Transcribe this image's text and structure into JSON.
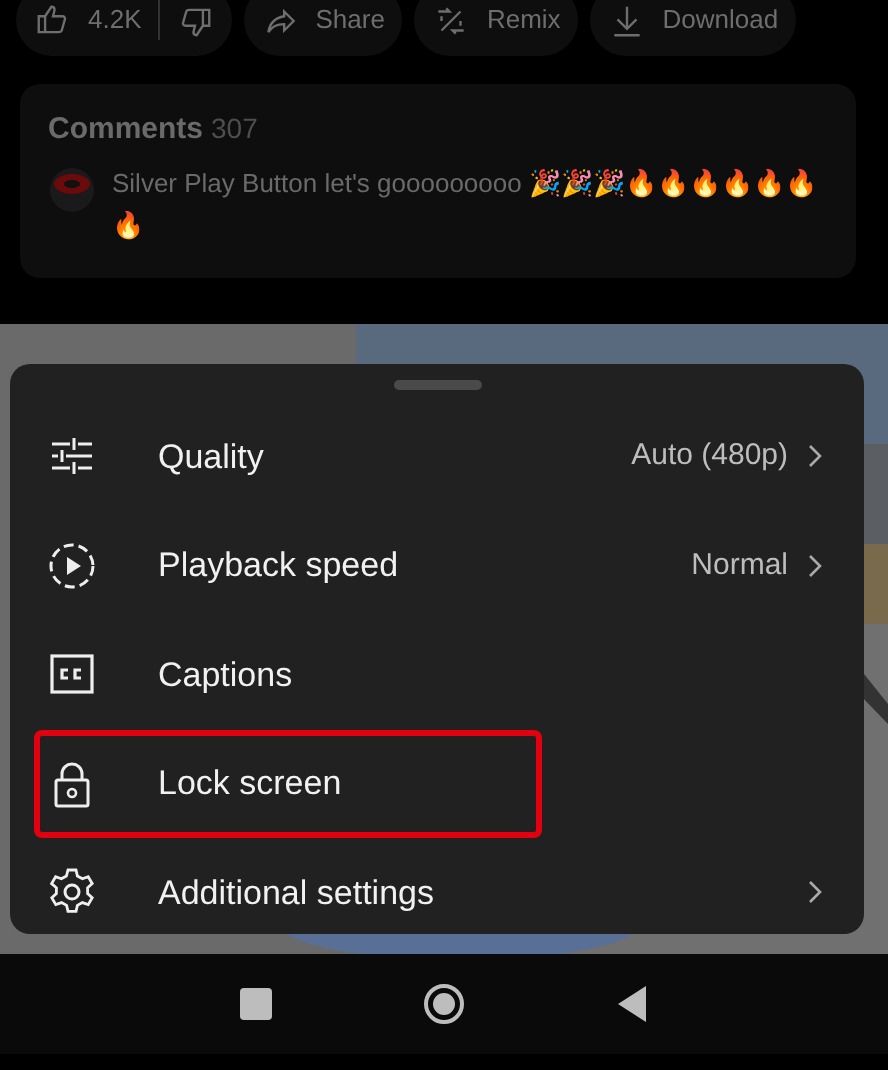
{
  "actions": [
    {
      "kind": "like",
      "label": "4.2K"
    },
    {
      "kind": "dislike"
    },
    {
      "kind": "share",
      "label": "Share"
    },
    {
      "kind": "remix",
      "label": "Remix"
    },
    {
      "kind": "download",
      "label": "Download"
    }
  ],
  "comments": {
    "title": "Comments",
    "count": "307",
    "text": "Silver Play Button let's gooooooooo 🎉🎉🎉🔥🔥🔥🔥🔥🔥🔥"
  },
  "settings_sheet": {
    "items": [
      {
        "kind": "sliders",
        "label": "Quality",
        "value": "Auto (480p)",
        "submenu": true,
        "highlighted": false
      },
      {
        "kind": "play",
        "label": "Playback speed",
        "value": "Normal",
        "submenu": true,
        "highlighted": false
      },
      {
        "kind": "cc",
        "label": "Captions",
        "submenu": false,
        "highlighted": false
      },
      {
        "kind": "lock",
        "label": "Lock screen",
        "submenu": false,
        "highlighted": true
      },
      {
        "kind": "gear",
        "label": "Additional settings",
        "submenu": true,
        "highlighted": false
      }
    ]
  },
  "nav_bar": [
    {
      "kind": "recents"
    },
    {
      "kind": "home"
    },
    {
      "kind": "back"
    }
  ]
}
